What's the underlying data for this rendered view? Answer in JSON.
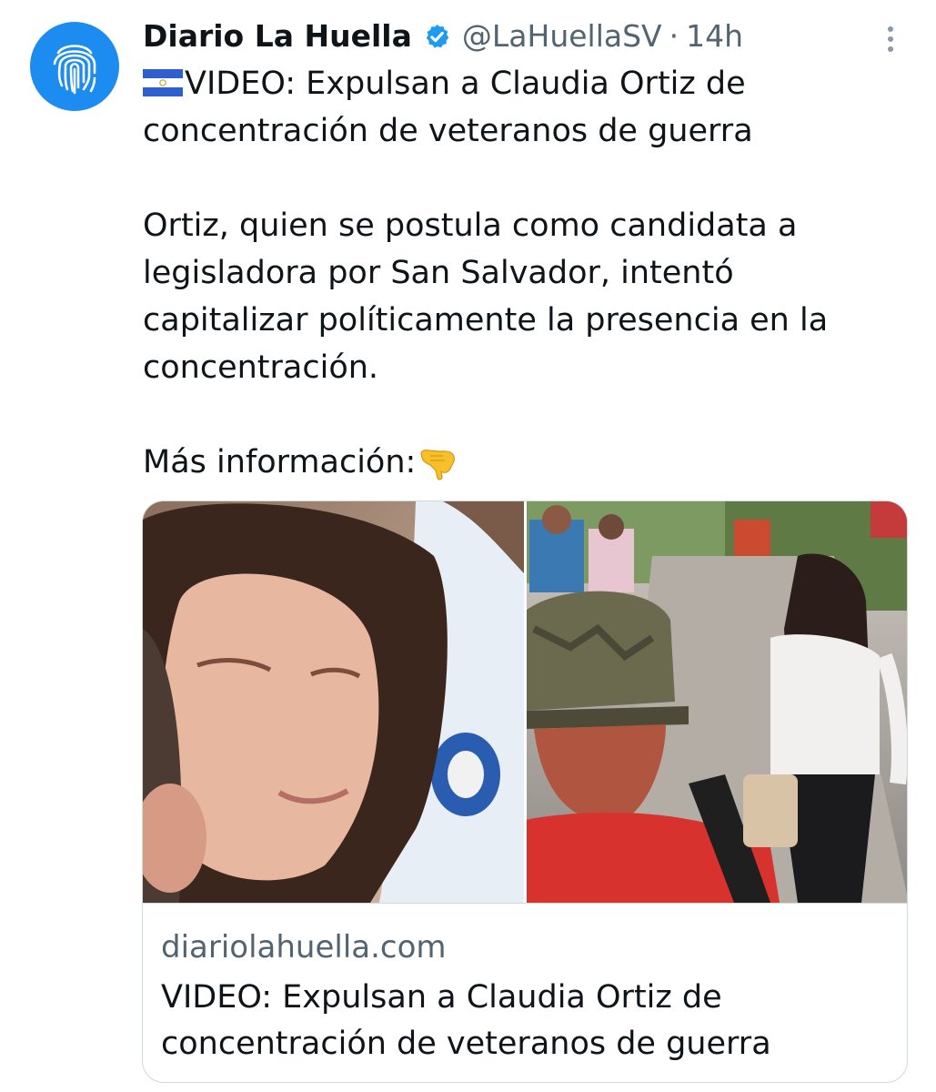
{
  "tweet": {
    "display_name": "Diario La Huella",
    "handle": "@LaHuellaSV",
    "separator": "·",
    "time": "14h",
    "verified_icon": "verified-badge-icon",
    "more_icon": "more-options-icon",
    "avatar_icon": "fingerprint-icon",
    "body": {
      "line1_flag": "el-salvador-flag-emoji",
      "line1": "VIDEO: Expulsan a Claudia Ortiz de",
      "line2": "concentración de veteranos de guerra",
      "line3": "Ortiz, quien se postula como candidata a",
      "line4": "legisladora por San Salvador, intentó",
      "line5": "capitalizar políticamente la presencia en la",
      "line6": "concentración.",
      "line7": "Más información:",
      "line7_emoji": "pointing-down-emoji"
    },
    "link_card": {
      "domain": "diariolahuella.com",
      "title_line1": "VIDEO: Expulsan a Claudia Ortiz de",
      "title_line2": "concentración de veteranos de guerra",
      "image": "news-photo-collage"
    }
  },
  "colors": {
    "accent": "#1d9bf0",
    "text": "#0f1419",
    "muted": "#536471",
    "border": "#cfd9de"
  }
}
